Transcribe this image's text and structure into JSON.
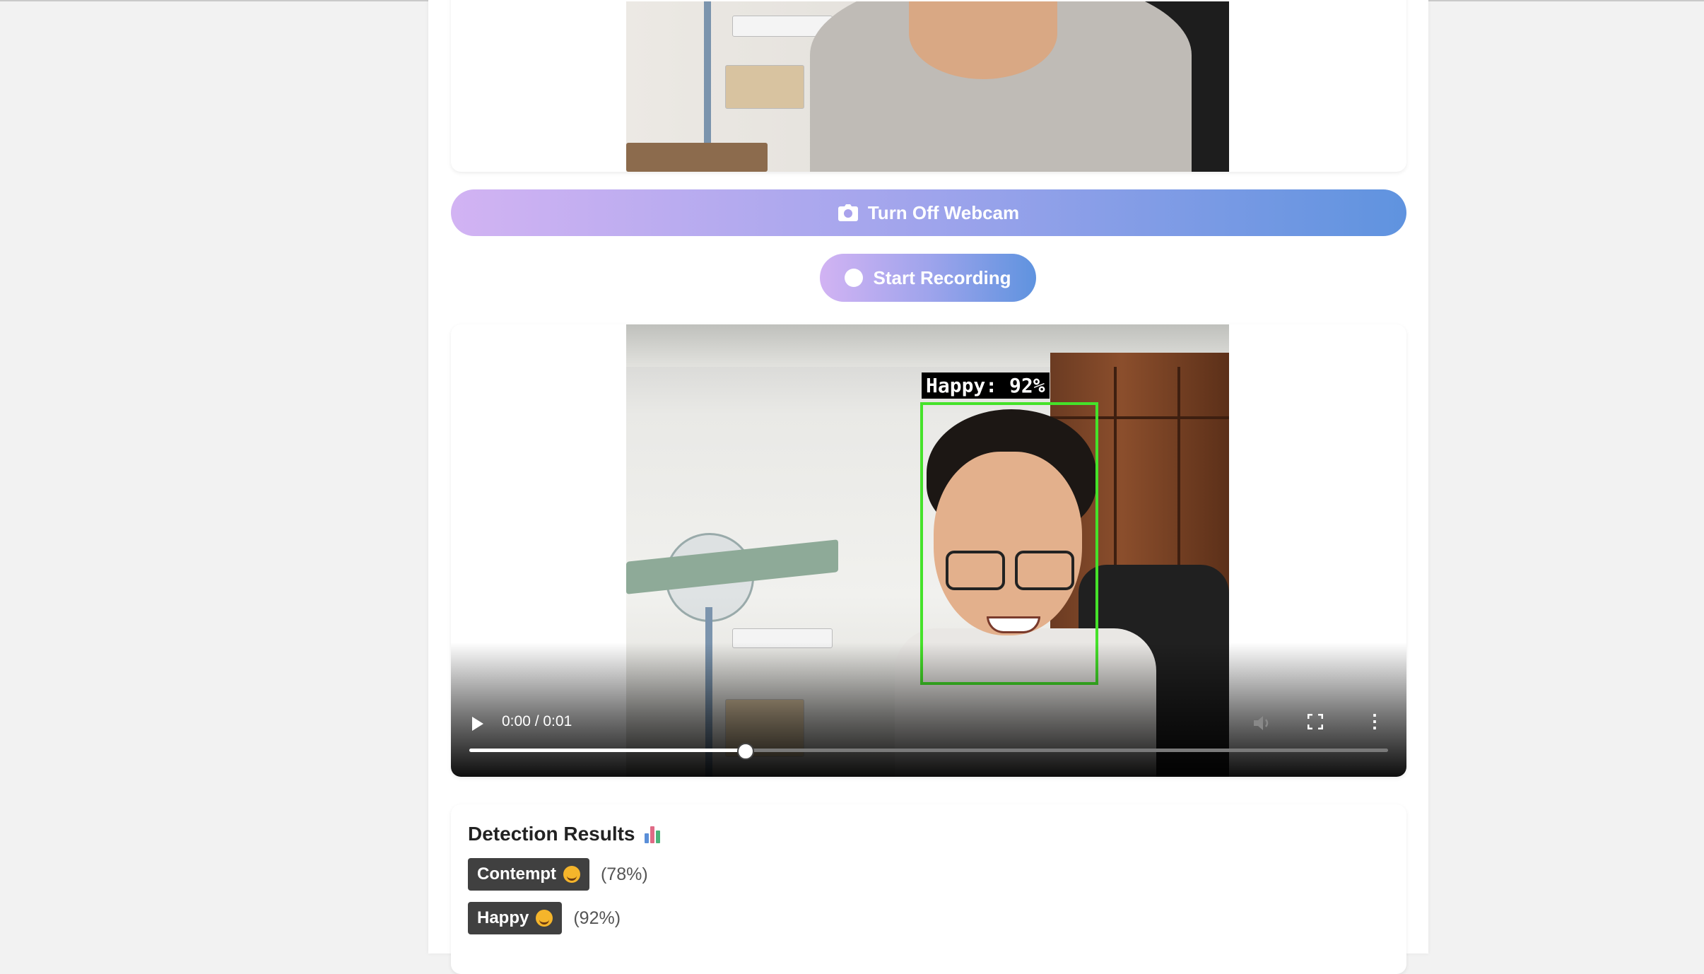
{
  "webcam_button": {
    "label": "Turn Off Webcam",
    "icon": "camera-icon"
  },
  "record_button": {
    "label": "Start Recording",
    "icon": "record-dot-icon"
  },
  "video_player": {
    "time": "0:00 / 0:01",
    "progress": 0.3,
    "detection_label": "Happy: 92%",
    "detection_box_color": "#45e22a"
  },
  "results": {
    "title": "Detection Results",
    "items": [
      {
        "emotion": "Contempt",
        "percent": "(78%)"
      },
      {
        "emotion": "Happy",
        "percent": "(92%)"
      }
    ]
  },
  "colors": {
    "gradient_start": "#d2b3f3",
    "gradient_end": "#5f93df",
    "badge_bg": "#404040"
  }
}
